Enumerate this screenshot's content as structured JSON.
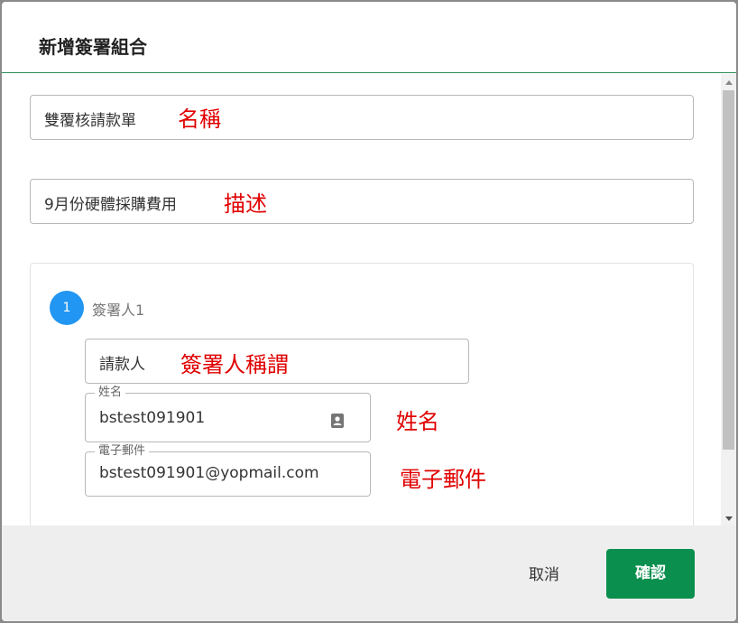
{
  "dialog": {
    "title": "新增簽署組合",
    "name_field": {
      "value": "雙覆核請款單",
      "annotation": "名稱"
    },
    "description_field": {
      "value": "9月份硬體採購費用",
      "annotation": "描述"
    },
    "signer": {
      "step_number": "1",
      "step_label": "簽署人1",
      "title_field": {
        "value": "請款人",
        "annotation": "簽署人稱謂"
      },
      "name_field": {
        "legend": "姓名",
        "value": "bstest091901",
        "annotation": "姓名",
        "icon": "contact-book-icon"
      },
      "email_field": {
        "legend": "電子郵件",
        "value": "bstest091901@yopmail.com",
        "annotation": "電子郵件"
      }
    },
    "footer": {
      "cancel_label": "取消",
      "confirm_label": "確認"
    }
  },
  "colors": {
    "annotation": "#e00000",
    "confirm_button": "#0b8f4e",
    "step_circle": "#2196f3",
    "header_divider": "#2e8b57"
  }
}
